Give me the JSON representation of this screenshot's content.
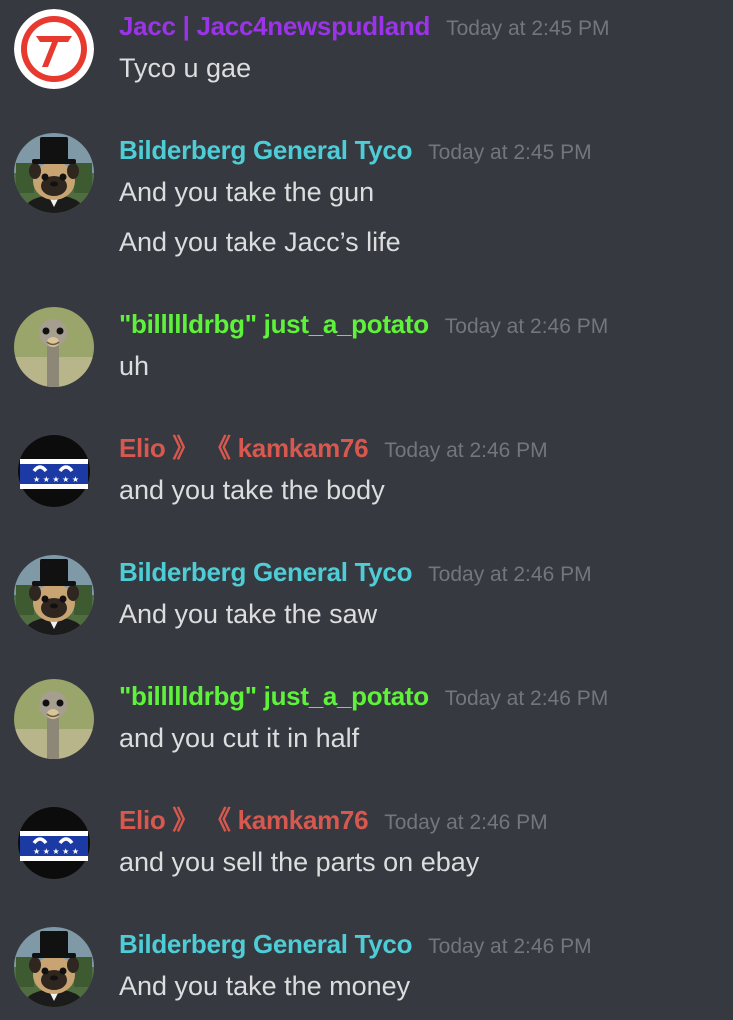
{
  "messages": [
    {
      "author": "Jacc | Jacc4newspudland",
      "author_color": "#9b33e8",
      "avatar": "red-v-logo-icon",
      "timestamp": "Today at 2:45 PM",
      "lines": [
        "Tyco u gae"
      ]
    },
    {
      "author": "Bilderberg General Tyco",
      "author_color": "#4ecdd6",
      "avatar": "pug-top-hat-icon",
      "timestamp": "Today at 2:45 PM",
      "lines": [
        "And you take the gun",
        "And you take Jacc’s life"
      ]
    },
    {
      "author": "\"billllldrbg\" just_a_potato",
      "author_color": "#5ef23a",
      "avatar": "ostrich-icon",
      "timestamp": "Today at 2:46 PM",
      "lines": [
        "uh"
      ]
    },
    {
      "author": "Elio 》 《 kamkam76",
      "author_color": "#d6584e",
      "avatar": "blue-ball-face-icon",
      "timestamp": "Today at 2:46 PM",
      "lines": [
        "and you take the body"
      ]
    },
    {
      "author": "Bilderberg General Tyco",
      "author_color": "#4ecdd6",
      "avatar": "pug-top-hat-icon",
      "timestamp": "Today at 2:46 PM",
      "lines": [
        "And you take the saw"
      ]
    },
    {
      "author": "\"billllldrbg\" just_a_potato",
      "author_color": "#5ef23a",
      "avatar": "ostrich-icon",
      "timestamp": "Today at 2:46 PM",
      "lines": [
        "and you cut it in half"
      ]
    },
    {
      "author": "Elio 》 《 kamkam76",
      "author_color": "#d6584e",
      "avatar": "blue-ball-face-icon",
      "timestamp": "Today at 2:46 PM",
      "lines": [
        "and you sell the parts on ebay"
      ]
    },
    {
      "author": "Bilderberg General Tyco",
      "author_color": "#4ecdd6",
      "avatar": "pug-top-hat-icon",
      "timestamp": "Today at 2:46 PM",
      "lines": [
        "And you take the money"
      ]
    }
  ]
}
